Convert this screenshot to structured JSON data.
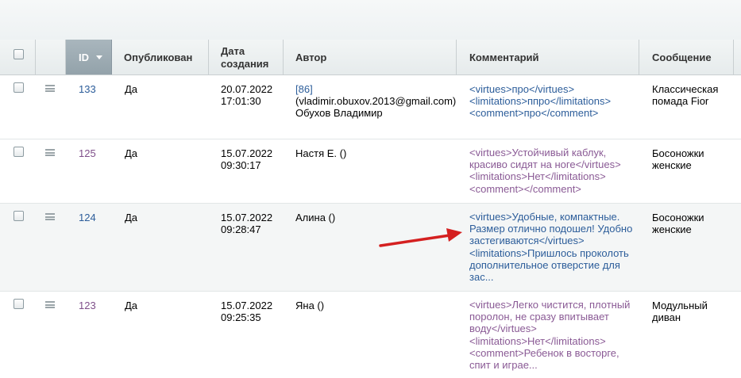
{
  "header": {
    "id": "ID",
    "published": "Опубликован",
    "date_line1": "Дата",
    "date_line2": "создания",
    "author": "Автор",
    "comment": "Комментарий",
    "message": "Сообщение"
  },
  "rows": [
    {
      "id": "133",
      "published": "Да",
      "date": "20.07.2022",
      "time": "17:01:30",
      "author_id": "[86]",
      "author_email": "(vladimir.obuxov.2013@gmail.com)",
      "author_name": "Обухов Владимир",
      "comment": [
        "<virtues>про</virtues>",
        "<limitations>ппро</limitations>",
        "<comment>про</comment>"
      ],
      "message": [
        "Классическая",
        "помада Fior"
      ]
    },
    {
      "id": "125",
      "published": "Да",
      "date": "15.07.2022",
      "time": "09:30:17",
      "author": "Настя Е. ()",
      "comment": [
        "<virtues>Устойчивый каблук,",
        "красиво сидят на ноге</virtues>",
        "<limitations>Нет</limitations>",
        "<comment></comment>"
      ],
      "message": [
        "Босоножки",
        "женские"
      ]
    },
    {
      "id": "124",
      "published": "Да",
      "date": "15.07.2022",
      "time": "09:28:47",
      "author": "Алина ()",
      "comment": [
        "<virtues>Удобные, компактные.",
        "Размер отлично подошел! Удобно",
        "застегиваются</virtues>",
        "<limitations>Пришлось проколоть",
        "дополнительное отверстие для",
        "зас..."
      ],
      "message": [
        "Босоножки",
        "женские"
      ]
    },
    {
      "id": "123",
      "published": "Да",
      "date": "15.07.2022",
      "time": "09:25:35",
      "author": "Яна ()",
      "comment": [
        "<virtues>Легко чистится, плотный",
        "поролон, не сразу впитывает",
        "воду</virtues>",
        "<limitations>Нет</limitations>",
        "<comment>Ребенок в восторге,",
        "спит и играе..."
      ],
      "message": [
        "Модульный",
        "диван"
      ]
    }
  ],
  "colors": {
    "link": "#2c5d9a",
    "visited_link": "#8a5a95",
    "annotation_arrow": "#d42020",
    "header_active": "#9aa7ae"
  },
  "icons": {
    "row_menu": "hamburger-menu-icon",
    "sort": "sort-desc-icon"
  }
}
